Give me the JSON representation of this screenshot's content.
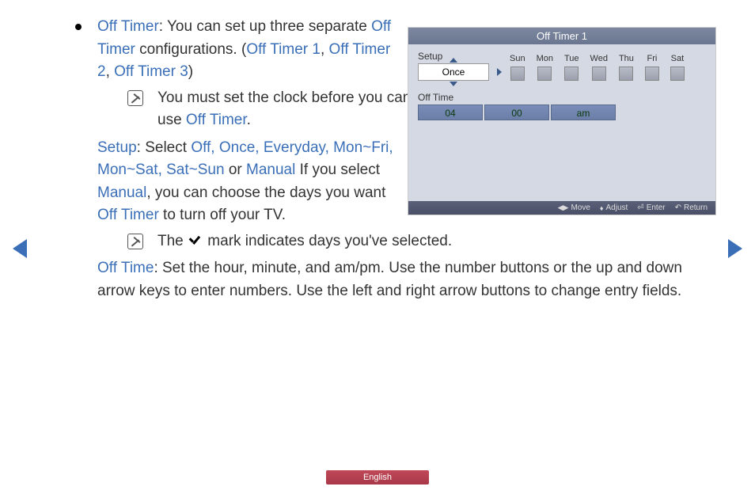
{
  "body": {
    "off_timer_label": "Off Timer",
    "off_timer_desc1": ": You can set up three separate ",
    "off_timer_label2": "Off Timer",
    "off_timer_desc2": " configurations. (",
    "t1": "Off Timer 1",
    "comma1": ", ",
    "t2": "Off Timer 2",
    "comma2": ", ",
    "t3": "Off Timer 3",
    "close": ")",
    "note1a": "You must set the clock before you can use ",
    "note1b": "Off Timer",
    "note1c": ".",
    "setup_label": "Setup",
    "setup_desc1": ": Select ",
    "setup_opts": "Off, Once, Everyday, Mon~Fri, Mon~Sat, Sat~Sun",
    "setup_or": " or ",
    "setup_manual": "Manual",
    "setup_desc2": " If you select ",
    "setup_manual2": "Manual",
    "setup_desc3": ", you can choose the days you want ",
    "setup_off_timer": "Off Timer",
    "setup_desc4": " to turn off your TV.",
    "note2a": "The ",
    "note2b": " mark indicates days you've selected.",
    "offtime_label": "Off Time",
    "offtime_desc": ": Set the hour, minute, and am/pm. Use the number buttons or the up and down arrow keys to enter numbers. Use the left and right arrow buttons to change entry fields."
  },
  "osd": {
    "title": "Off Timer 1",
    "setup_label": "Setup",
    "setup_value": "Once",
    "days": [
      "Sun",
      "Mon",
      "Tue",
      "Wed",
      "Thu",
      "Fri",
      "Sat"
    ],
    "offtime_label": "Off Time",
    "hour": "04",
    "minute": "00",
    "ampm": "am",
    "footer": {
      "move": "Move",
      "adjust": "Adjust",
      "enter": "Enter",
      "return": "Return"
    }
  },
  "lang": "English"
}
